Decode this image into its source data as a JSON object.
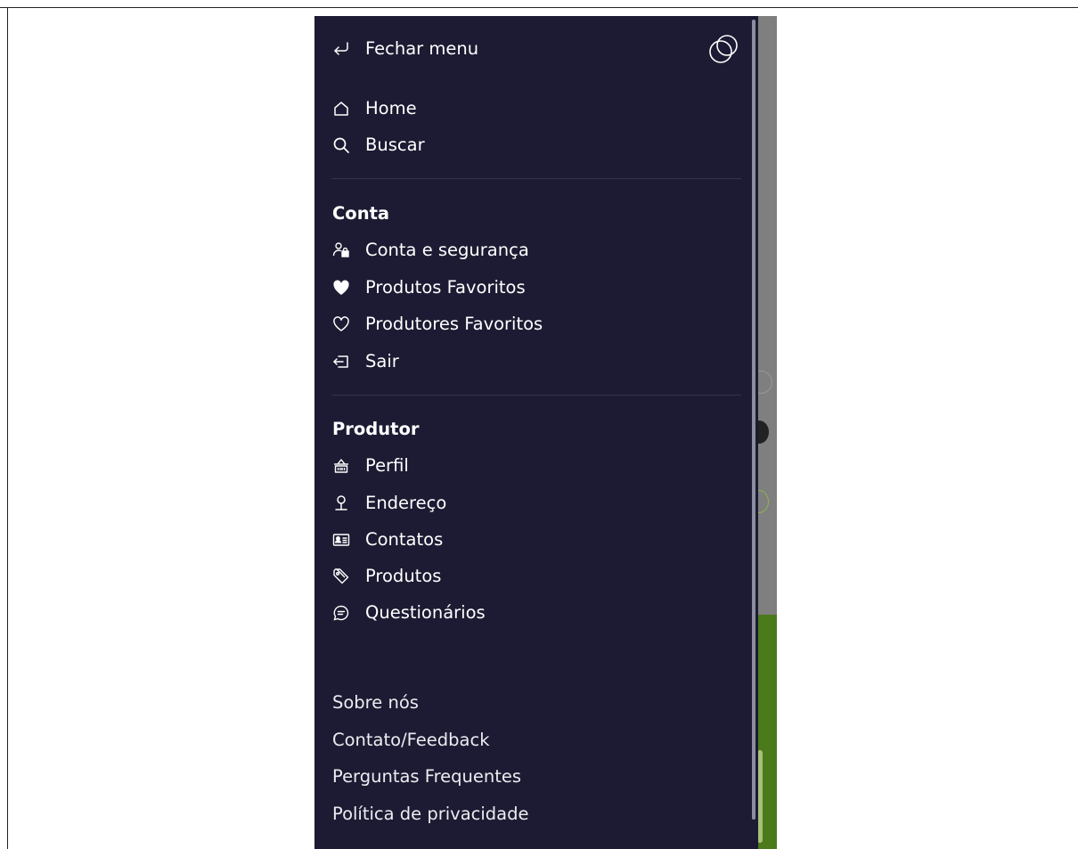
{
  "menu": {
    "close_label": "Fechar menu",
    "nav": [
      {
        "label": "Home",
        "icon": "home-icon"
      },
      {
        "label": "Buscar",
        "icon": "search-icon"
      }
    ],
    "account": {
      "title": "Conta",
      "items": [
        {
          "label": "Conta e segurança",
          "icon": "user-lock-icon"
        },
        {
          "label": "Produtos Favoritos",
          "icon": "heart-filled-icon"
        },
        {
          "label": "Produtores Favoritos",
          "icon": "heart-outline-icon"
        },
        {
          "label": "Sair",
          "icon": "logout-icon"
        }
      ]
    },
    "producer": {
      "title": "Produtor",
      "items": [
        {
          "label": "Perfil",
          "icon": "basket-icon"
        },
        {
          "label": "Endereço",
          "icon": "map-pin-icon"
        },
        {
          "label": "Contatos",
          "icon": "contact-card-icon"
        },
        {
          "label": "Produtos",
          "icon": "tag-icon"
        },
        {
          "label": "Questionários",
          "icon": "chat-bubble-icon"
        }
      ]
    },
    "footer_links": [
      "Sobre nós",
      "Contato/Feedback",
      "Perguntas Frequentes",
      "Política de privacidade"
    ]
  },
  "colors": {
    "drawer_bg": "#1c1b33",
    "text": "#ffffff",
    "backdrop": "#7f7f7f",
    "accent_green": "#4b7a1b"
  }
}
